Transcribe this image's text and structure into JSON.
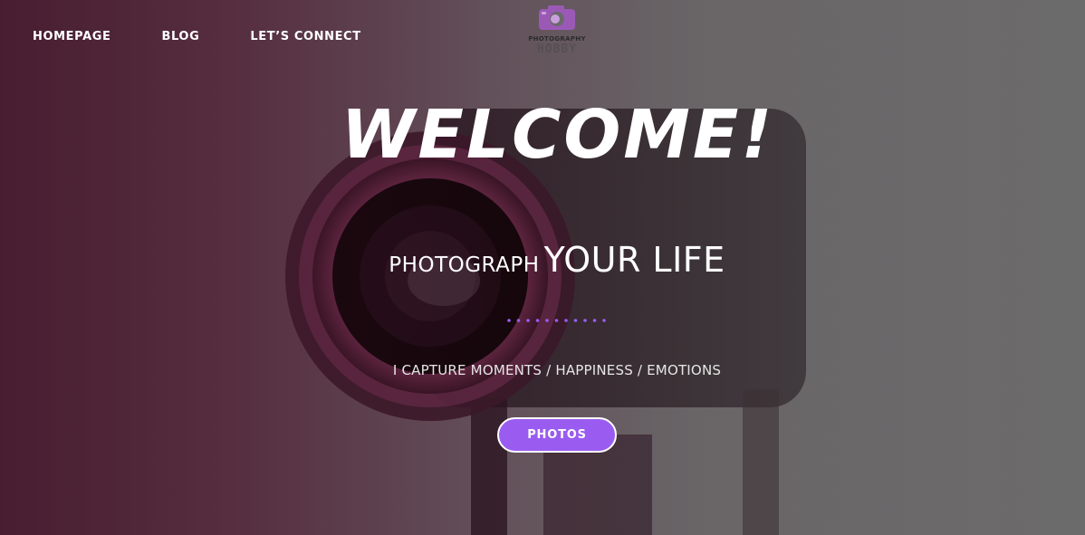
{
  "nav": {
    "items": [
      {
        "label": "HOMEPAGE"
      },
      {
        "label": "BLOG"
      },
      {
        "label": "LET’S CONNECT"
      }
    ]
  },
  "logo": {
    "text": "PHOTOGRAPHY",
    "subtext": "HOBBY",
    "icon": "camera-icon",
    "color": "#9b59b6"
  },
  "hero": {
    "title": "WELCOME!",
    "tagline_light": "PHOTOGRAPH",
    "tagline_bold": "YOUR LIFE",
    "subtitle": "I CAPTURE MOMENTS / HAPPINESS / EMOTIONS",
    "button_label": "PHOTOS",
    "accent_color": "#9a5cf0"
  }
}
